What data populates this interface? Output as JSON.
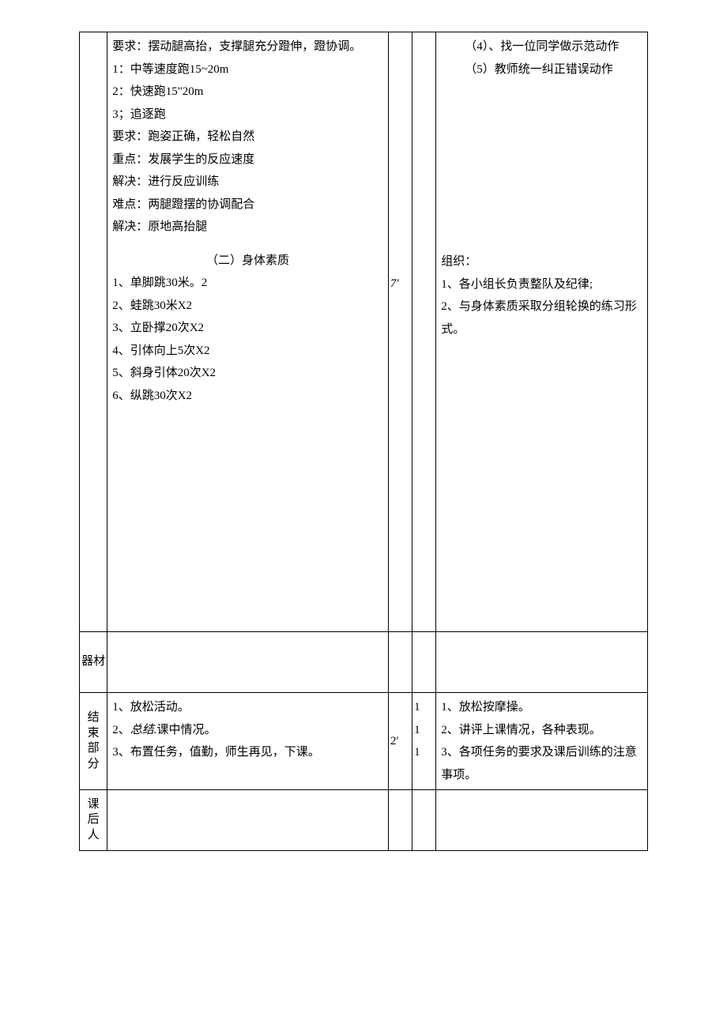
{
  "row1": {
    "req1": "要求：摆动腿高抬，支撑腿充分蹬伸，蹬协调。",
    "l1": "1：中等速度跑15~20m",
    "l2": "2：快速跑15\"20m",
    "l3": "3；追逐跑",
    "req2": "要求：跑姿正确，轻松自然",
    "key1": "重点：发展学生的反应速度",
    "key2": "解决：进行反应训练",
    "key3": "难点：两腿蹬摆的协调配合",
    "key4": "解决：原地高抬腿",
    "sec2title": "（二）身体素质",
    "q1": "1、单脚跳30米。2",
    "q2": "2、蛙跳30米X2",
    "q3": "3、立卧撑20次X2",
    "q4": "4、引体向上5次X2",
    "q5": "5、斜身引体20次X2",
    "q6": "6、纵跳30次X2",
    "mid": "7′",
    "r4": "（4）、找一位同学做示范动作",
    "r5": "（5）教师统一纠正错误动作",
    "org_label": "组织：",
    "org1": "1、各小组长负责整队及纪律;",
    "org2": "2、与身体素质采取分组轮换的练习形式。"
  },
  "row_qc": {
    "label": "器材"
  },
  "row_end": {
    "label_c1": "结",
    "label_c2": "束",
    "label_c3": "部",
    "label_c4": "分",
    "c1": "1、放松活动。",
    "c2_a": "2、",
    "c2_b": "总结.",
    "c2_c": "课中情况。",
    "c3": "3、布置任务，值勤，师生再见，下课。",
    "mid": "2′",
    "t1": "1",
    "t2": "1",
    "t3": "1",
    "r1": "1、放松按摩操。",
    "r2": "2、讲评上课情况，各种表现。",
    "r3": "3、各项任务的要求及课后训练的注意事项。"
  },
  "row_after": {
    "label_c1": "课",
    "label_c2": "后",
    "label_c3": "人"
  }
}
